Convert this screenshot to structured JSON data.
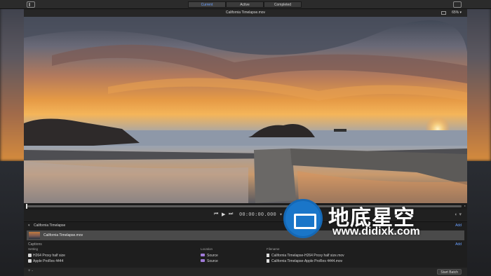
{
  "tabs": [
    {
      "label": "Current",
      "active": true
    },
    {
      "label": "Active",
      "active": false
    },
    {
      "label": "Completed",
      "active": false
    }
  ],
  "viewer": {
    "title": "California Timelapse.mov",
    "zoom": "65%"
  },
  "transport": {
    "timecode": "00:00:00.000"
  },
  "batch": {
    "name": "California Timelapse",
    "add_label": "Add",
    "file_name": "California Timelapse.mov",
    "captions_label": "Captions",
    "captions_add_label": "Add",
    "columns": {
      "setting": "Setting",
      "location": "Location",
      "filename": "Filename"
    },
    "rows": [
      {
        "setting": "H264 Proxy half size",
        "location": "Source",
        "filename": "California Timelapse-H264 Proxy half size.mov"
      },
      {
        "setting": "Apple ProRes 4444",
        "location": "Source",
        "filename": "California Timelapse-Apple ProRes 4444.mov"
      }
    ]
  },
  "bottombar": {
    "add_remove": "+ -",
    "start_label": "Start Batch"
  },
  "watermark": {
    "cn_text": "地底星空",
    "url": "www.didixk.com"
  },
  "colors": {
    "accent": "#6aa0ff",
    "folder": "#a07ad8",
    "watermark_blue": "#1a76c9"
  }
}
